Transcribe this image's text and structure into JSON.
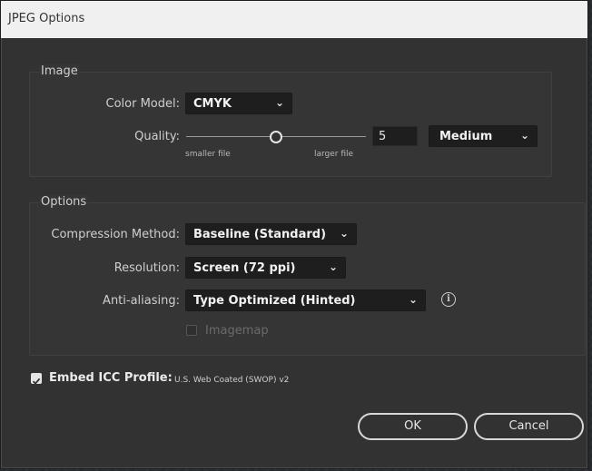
{
  "title": "JPEG Options",
  "image_group": {
    "title": "Image",
    "color_model": {
      "label": "Color Model:",
      "value": "CMYK"
    },
    "quality": {
      "label": "Quality:",
      "value": "5",
      "level": 0.5,
      "min_label": "smaller file",
      "max_label": "larger file",
      "preset": "Medium"
    }
  },
  "options_group": {
    "title": "Options",
    "compression": {
      "label": "Compression Method:",
      "value": "Baseline (Standard)"
    },
    "resolution": {
      "label": "Resolution:",
      "value": "Screen (72 ppi)"
    },
    "anti_aliasing": {
      "label": "Anti-aliasing:",
      "value": "Type Optimized (Hinted)"
    },
    "imagemap": {
      "label": "Imagemap",
      "checked": false,
      "enabled": false
    }
  },
  "embed_icc": {
    "label": "Embed ICC Profile:",
    "profile": "U.S. Web Coated (SWOP) v2",
    "checked": true
  },
  "buttons": {
    "ok": "OK",
    "cancel": "Cancel"
  },
  "icons": {
    "chevron": "chevron-down-icon",
    "info": "info-icon",
    "check": "checkmark-icon"
  },
  "colors": {
    "panel": "#323232",
    "field": "#1e1e1e",
    "text": "#cfcfcf"
  }
}
